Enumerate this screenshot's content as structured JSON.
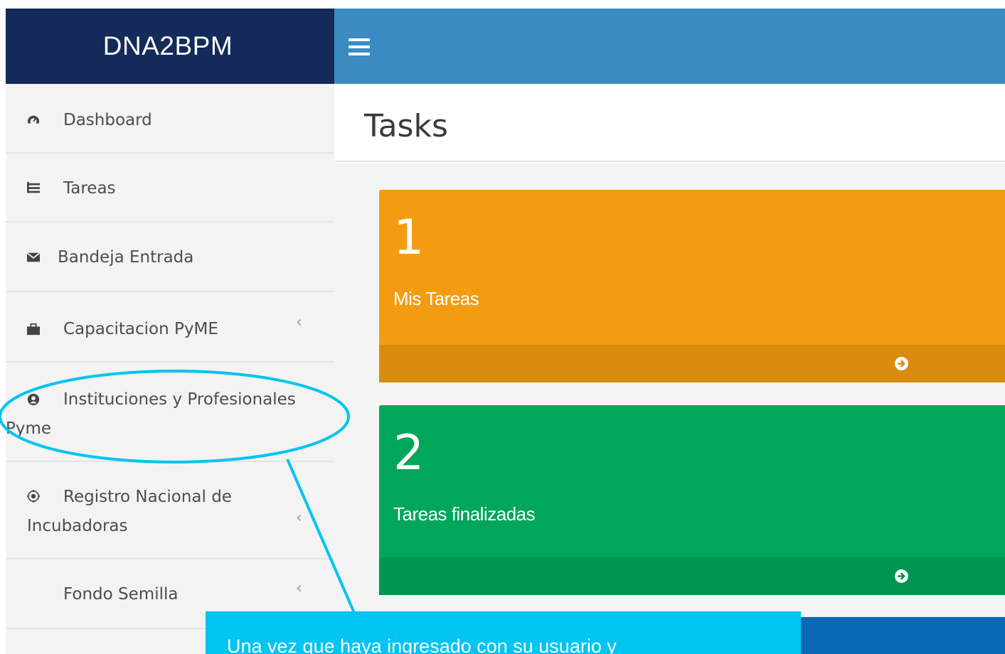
{
  "app": {
    "brand": "DNA2BPM"
  },
  "header": {
    "menu_icon": "hamburger-icon"
  },
  "sidebar": {
    "items": [
      {
        "lines": [
          "Dashboard"
        ],
        "icon": "dashboard-icon"
      },
      {
        "lines": [
          "Tareas"
        ],
        "icon": "tasks-icon"
      },
      {
        "lines": [
          "Bandeja Entrada"
        ],
        "icon": "envelope-icon"
      },
      {
        "lines": [
          "Capacitacion PyME"
        ],
        "icon": "briefcase-icon",
        "chevron": "‹"
      },
      {
        "lines": [
          "Instituciones y Profesionales",
          "Pyme"
        ],
        "icon": "user-circle-icon"
      },
      {
        "lines": [
          "Registro Nacional de",
          "Incubadoras"
        ],
        "icon": "eye-icon",
        "chevron": "‹"
      },
      {
        "lines": [
          "Fondo Semilla"
        ],
        "chevron": "‹"
      }
    ]
  },
  "main": {
    "title": "Tasks",
    "boxes": [
      {
        "number": "1",
        "label": "Mis Tareas",
        "color": "#f39c12",
        "footer_color": "#da8c10"
      },
      {
        "number": "2",
        "label": "Tareas finalizadas",
        "color": "#00a65a",
        "footer_color": "#009551"
      }
    ]
  },
  "tooltip": {
    "text": "Una vez que haya ingresado con su usuario y"
  },
  "colors": {
    "brand_bg": "#132a5a",
    "topbar_bg": "#3b8bc2",
    "sidebar_bg": "#f3f3f3",
    "callout": "#00c4f2",
    "bottom_blue": "#0a68b4"
  }
}
